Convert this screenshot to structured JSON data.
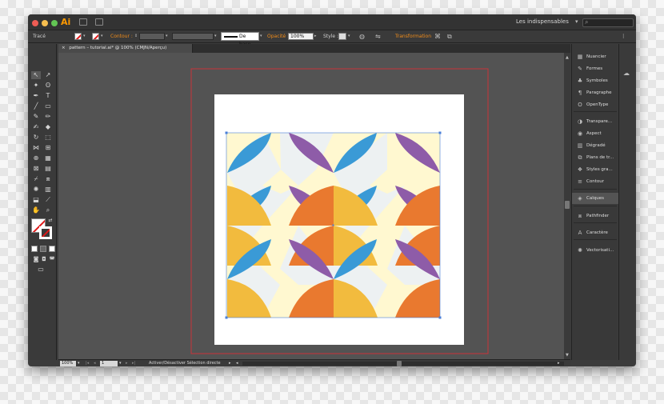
{
  "app": {
    "logo": "Ai"
  },
  "titlebar": {
    "workspace": "Les indispensables",
    "workspace_caret": "▾",
    "search_placeholder": ""
  },
  "controlbar": {
    "selection_label": "Tracé",
    "stroke_label": "Contour :",
    "stroke_profile": "De base",
    "opacity_label": "Opacité :",
    "opacity_value": "100%",
    "style_label": "Style :",
    "transform_label": "Transformation"
  },
  "document_tab": {
    "close": "×",
    "title": "pattern – tutorial.ai* @ 100% (CMJN/Aperçu)"
  },
  "statusbar": {
    "zoom": "100%",
    "artboard": "1",
    "status_text": "Activer/Désactiver Sélection directe"
  },
  "panels": [
    {
      "label": "Nuancier",
      "icon": "swatches-icon"
    },
    {
      "label": "Formes",
      "icon": "brushes-icon"
    },
    {
      "label": "Symboles",
      "icon": "symbols-icon"
    },
    {
      "label": "Paragraphe",
      "icon": "paragraph-icon"
    },
    {
      "label": "OpenType",
      "icon": "opentype-icon"
    },
    {
      "label": "Transpare...",
      "icon": "transparency-icon"
    },
    {
      "label": "Aspect",
      "icon": "appearance-icon"
    },
    {
      "label": "Dégradé",
      "icon": "gradient-icon"
    },
    {
      "label": "Plans de tr...",
      "icon": "artboards-icon"
    },
    {
      "label": "Styles gra...",
      "icon": "graphic-styles-icon"
    },
    {
      "label": "Contour",
      "icon": "stroke-icon"
    },
    {
      "label": "Calques",
      "icon": "layers-icon"
    },
    {
      "label": "Pathfinder",
      "icon": "pathfinder-icon"
    },
    {
      "label": "Caractère",
      "icon": "character-icon"
    },
    {
      "label": "Vectorisati...",
      "icon": "image-trace-icon"
    }
  ],
  "pattern_colors": {
    "background": "#fff8d0",
    "ground": "#edf1f2",
    "blue": "#3a9ad6",
    "purple": "#8e5ca8",
    "yellow": "#f2bb3e",
    "orange": "#e9792f"
  },
  "toolbox": {
    "tools": [
      "selection-tool",
      "direct-selection-tool",
      "magic-wand-tool",
      "lasso-tool",
      "pen-tool",
      "type-tool",
      "line-tool",
      "rectangle-tool",
      "paintbrush-tool",
      "pencil-tool",
      "blob-brush-tool",
      "eraser-tool",
      "rotate-tool",
      "scale-tool",
      "width-tool",
      "free-transform-tool",
      "shape-builder-tool",
      "perspective-grid-tool",
      "mesh-tool",
      "gradient-tool",
      "eyedropper-tool",
      "blend-tool",
      "symbol-sprayer-tool",
      "column-graph-tool",
      "artboard-tool",
      "slice-tool",
      "hand-tool",
      "zoom-tool"
    ]
  }
}
